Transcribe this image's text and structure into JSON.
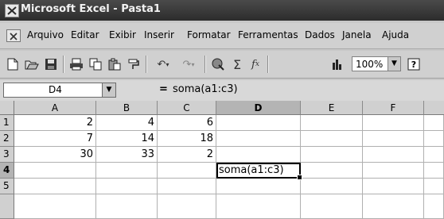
{
  "window": {
    "title": "Microsoft Excel - Pasta1"
  },
  "menu": {
    "items": [
      "Arquivo",
      "Editar",
      "Exibir",
      "Inserir",
      "Formatar",
      "Ferramentas",
      "Dados",
      "Janela",
      "Ajuda"
    ]
  },
  "toolbar": {
    "buttons": [
      "new-icon",
      "open-icon",
      "save-icon",
      "print-icon",
      "copy-icon",
      "paste-icon",
      "format-painter-icon",
      "undo-icon",
      "redo-icon",
      "hyperlink-icon",
      "autosum-icon",
      "function-icon",
      "chart-wizard-icon",
      "help-icon"
    ],
    "zoom": "100%"
  },
  "formula_bar": {
    "name_box": "D4",
    "equals": "=",
    "formula": "soma(a1:c3)"
  },
  "sheet": {
    "columns": [
      "A",
      "B",
      "C",
      "D",
      "E",
      "F"
    ],
    "rows": [
      "1",
      "2",
      "3",
      "4",
      "5"
    ],
    "cells": {
      "A1": "2",
      "B1": "4",
      "C1": "6",
      "A2": "7",
      "B2": "14",
      "C2": "18",
      "A3": "30",
      "B3": "33",
      "C3": "2",
      "D4": "soma(a1:c3)"
    },
    "active_cell": "D4"
  }
}
